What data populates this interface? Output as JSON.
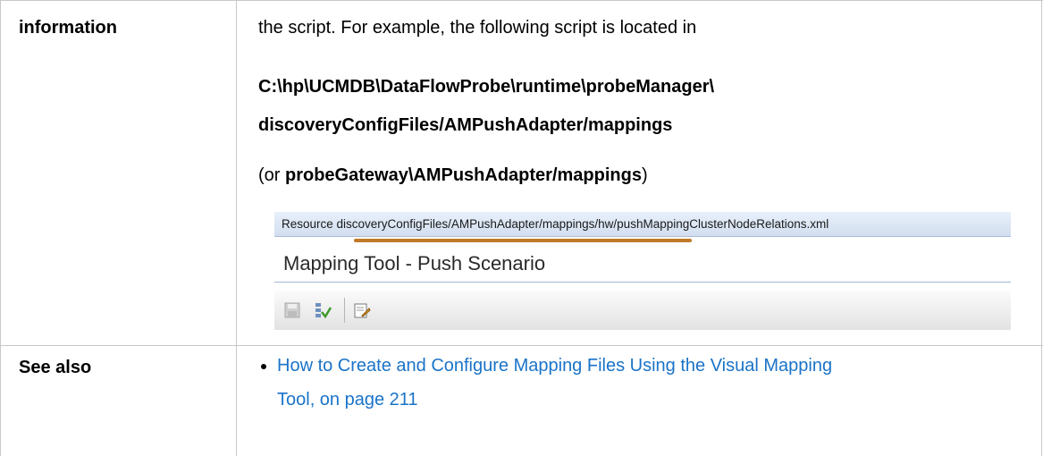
{
  "rows": [
    {
      "label": "information",
      "lines": [
        {
          "text": "the script. For example, the following script is located in"
        },
        {
          "path_line1": "C:\\hp\\UCMDB\\DataFlowProbe\\runtime\\probeManager\\"
        },
        {
          "path_line2": "discoveryConfigFiles/AMPushAdapter/mappings"
        }
      ],
      "or_open": "(or ",
      "or_bold": "probeGateway\\AMPushAdapter/mappings",
      "or_close": ")",
      "screenshot": {
        "resource_text": "Resource discoveryConfigFiles/AMPushAdapter/mappings/hw/pushMappingClusterNodeRelations.xml",
        "tool_title": "Mapping Tool - Push Scenario",
        "toolbar_icons": [
          "save-icon",
          "validate-icon",
          "edit-notes-icon"
        ],
        "underline_color": "#c07a2a"
      }
    },
    {
      "label": "See also",
      "links": [
        {
          "line1": "How to Create and Configure Mapping Files Using the Visual Mapping",
          "line2": "Tool, on page 211"
        }
      ],
      "link_color": "#1a73c8"
    }
  ]
}
